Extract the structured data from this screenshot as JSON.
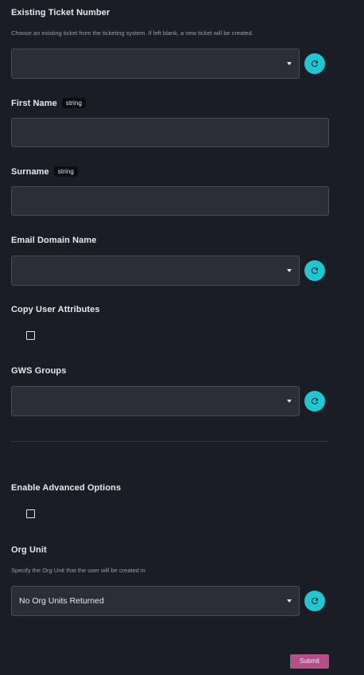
{
  "form": {
    "ticket": {
      "label": "Existing Ticket Number",
      "help": "Choose an existing ticket from the ticketing system. If left blank, a new ticket will be created.",
      "value": ""
    },
    "first_name": {
      "label": "First Name",
      "type_tag": "string",
      "value": ""
    },
    "surname": {
      "label": "Surname",
      "type_tag": "string",
      "value": ""
    },
    "email_domain": {
      "label": "Email Domain Name",
      "value": ""
    },
    "copy_attributes": {
      "label": "Copy User Attributes",
      "checked": false
    },
    "gws_groups": {
      "label": "GWS Groups",
      "value": ""
    },
    "advanced": {
      "label": "Enable Advanced Options",
      "checked": false
    },
    "org_unit": {
      "label": "Org Unit",
      "help": "Specify the Org Unit that the user will be created in",
      "value": "No Org Units Returned"
    },
    "submit_label": "Submit"
  },
  "colors": {
    "background": "#1b1d26",
    "field": "#2c2d39",
    "refresh_button": "#1ec8d1",
    "submit_button": "#b3508a"
  },
  "icons": {
    "refresh": "refresh-icon",
    "dropdown": "caret-down-icon"
  }
}
